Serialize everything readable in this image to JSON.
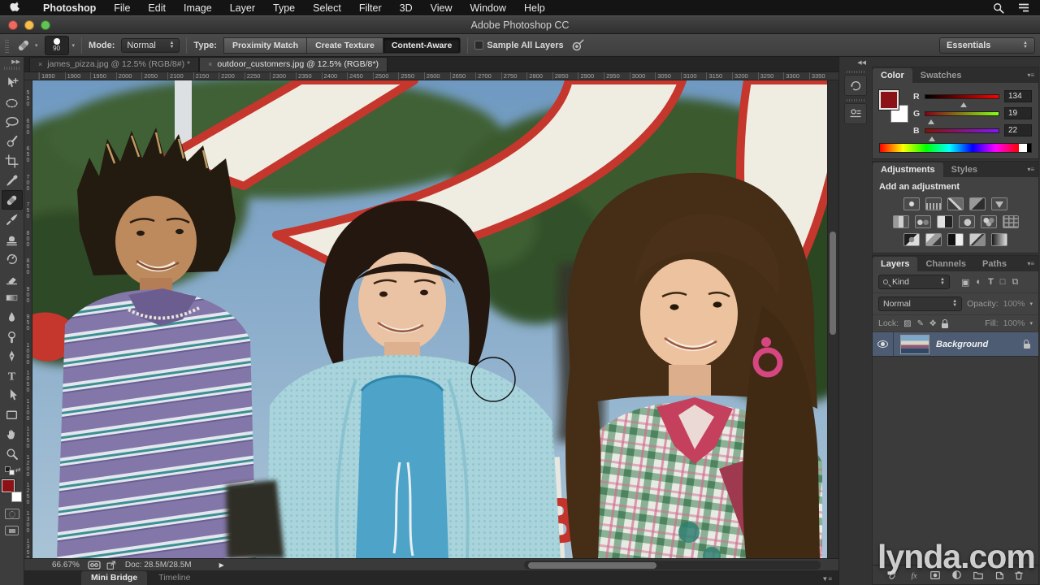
{
  "menu_bar": {
    "items": [
      {
        "label": "Photoshop",
        "bold": true
      },
      {
        "label": "File"
      },
      {
        "label": "Edit"
      },
      {
        "label": "Image"
      },
      {
        "label": "Layer"
      },
      {
        "label": "Type"
      },
      {
        "label": "Select"
      },
      {
        "label": "Filter"
      },
      {
        "label": "3D"
      },
      {
        "label": "View"
      },
      {
        "label": "Window"
      },
      {
        "label": "Help"
      }
    ],
    "right_icons": [
      "spotlight-search-icon",
      "notification-list-icon"
    ]
  },
  "title_bar": {
    "title": "Adobe Photoshop CC"
  },
  "options_bar": {
    "tool_icon": "spot-healing-brush-icon",
    "brush_size": "90",
    "mode_label": "Mode:",
    "mode_value": "Normal",
    "type_label": "Type:",
    "type_buttons": [
      {
        "label": "Proximity Match"
      },
      {
        "label": "Create Texture"
      },
      {
        "label": "Content-Aware",
        "selected": true
      }
    ],
    "sample_all_layers_label": "Sample All Layers",
    "pressure_icon": "tablet-pressure-icon",
    "workspace_value": "Essentials"
  },
  "document_tabs": [
    {
      "label": "james_pizza.jpg @ 12.5% (RGB/8#) *"
    },
    {
      "label": "outdoor_customers.jpg @ 12.5% (RGB/8*)",
      "active": true
    }
  ],
  "rulers": {
    "horizontal": [
      "1850",
      "1900",
      "1950",
      "2000",
      "2050",
      "2100",
      "2150",
      "2200",
      "2250",
      "2300",
      "2350",
      "2400",
      "2450",
      "2500",
      "2550",
      "2600",
      "2650",
      "2700",
      "2750",
      "2800",
      "2850",
      "2900",
      "2950",
      "3000",
      "3050",
      "3100",
      "3150",
      "3200",
      "3250",
      "3300",
      "3350"
    ],
    "vertical": [
      "550",
      "600",
      "650",
      "700",
      "750",
      "800",
      "850",
      "900",
      "950",
      "1000",
      "1050",
      "1100",
      "1150",
      "1200",
      "1250",
      "1300",
      "1350"
    ]
  },
  "tools": [
    "move-tool",
    "marquee-tool",
    "lasso-tool",
    "quick-selection-tool",
    "crop-tool",
    "eyedropper-tool",
    "spot-healing-brush-tool",
    "brush-tool",
    "clone-stamp-tool",
    "history-brush-tool",
    "eraser-tool",
    "gradient-tool",
    "blur-tool",
    "dodge-tool",
    "pen-tool",
    "type-tool",
    "path-selection-tool",
    "shape-tool",
    "hand-tool",
    "zoom-tool"
  ],
  "selected_tool": "spot-healing-brush-tool",
  "dock_strip_icons": [
    "history-panel-icon",
    "properties-panel-icon"
  ],
  "color_panel": {
    "tabs": [
      {
        "label": "Color",
        "active": true
      },
      {
        "label": "Swatches"
      }
    ],
    "channels": [
      {
        "label": "R",
        "value": "134"
      },
      {
        "label": "G",
        "value": "19"
      },
      {
        "label": "B",
        "value": "22"
      }
    ],
    "foreground_color": "#8b1216",
    "background_color": "#ffffff"
  },
  "adjustments_panel": {
    "tabs": [
      {
        "label": "Adjustments",
        "active": true
      },
      {
        "label": "Styles"
      }
    ],
    "heading": "Add an adjustment",
    "icons_row1": [
      "brightness-contrast-icon",
      "levels-icon",
      "curves-icon",
      "exposure-icon",
      "vibrance-icon"
    ],
    "icons_row2": [
      "hue-saturation-icon",
      "color-balance-icon",
      "black-white-icon",
      "photo-filter-icon",
      "channel-mixer-icon",
      "color-lookup-icon"
    ],
    "icons_row3": [
      "invert-icon",
      "posterize-icon",
      "threshold-icon",
      "selective-color-icon",
      "gradient-map-icon"
    ]
  },
  "layers_panel": {
    "tabs": [
      {
        "label": "Layers",
        "active": true
      },
      {
        "label": "Channels"
      },
      {
        "label": "Paths"
      }
    ],
    "filter_value": "Kind",
    "filter_icons": [
      "pixel-layer-filter-icon",
      "adjustment-layer-filter-icon",
      "type-layer-filter-icon",
      "shape-layer-filter-icon",
      "smart-object-filter-icon"
    ],
    "blend_mode": "Normal",
    "opacity_label": "Opacity:",
    "opacity_value": "100%",
    "lock_label": "Lock:",
    "lock_icons": [
      "lock-transparent-icon",
      "lock-pixels-icon",
      "lock-position-icon",
      "lock-all-icon"
    ],
    "fill_label": "Fill:",
    "fill_value": "100%",
    "layers": [
      {
        "name": "Background",
        "locked": true,
        "visible": true
      }
    ],
    "bottom_icons": [
      "link-layers-icon",
      "layer-style-fx-icon",
      "add-layer-mask-icon",
      "new-adjustment-layer-icon",
      "new-group-icon",
      "new-layer-icon",
      "delete-layer-icon"
    ]
  },
  "status_bar": {
    "zoom_value": "66.67%",
    "icons": [
      "mini-bridge-launcher-icon",
      "export-icon"
    ],
    "doc_info": "Doc: 28.5M/28.5M",
    "play_icon": "status-detail-arrow-icon"
  },
  "bottom_tabs": [
    {
      "label": "Mini Bridge",
      "active": true
    },
    {
      "label": "Timeline"
    }
  ],
  "watermark": "lynda.com",
  "colors": {
    "foreground_swatch": "#8b1216",
    "selected_layer_highlight": "#4d5c73",
    "sign_red": "#c5362d"
  }
}
